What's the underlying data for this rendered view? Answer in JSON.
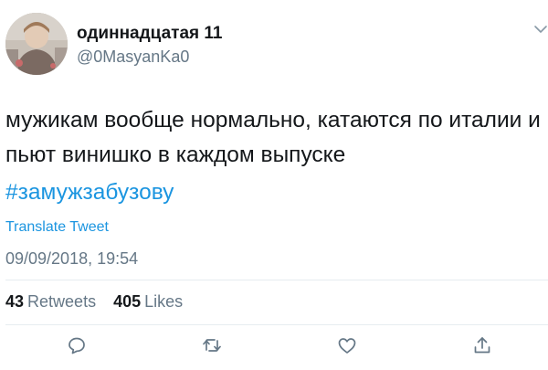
{
  "tweet": {
    "display_name": "одиннадцатая 11",
    "handle": "@0MasyanKa0",
    "text": "мужикам вообще нормально, катаются по италии и пьют винишко в каждом выпуске",
    "hashtag": "#замужзабузову",
    "translate_label": "Translate Tweet",
    "timestamp": "09/09/2018, 19:54"
  },
  "stats": {
    "retweets_count": "43",
    "retweets_label": "Retweets",
    "likes_count": "405",
    "likes_label": "Likes"
  },
  "icons": {
    "reply": "reply-icon",
    "retweet": "retweet-icon",
    "like": "like-icon",
    "share": "share-icon",
    "menu": "chevron-down-icon"
  },
  "colors": {
    "link": "#1b95e0",
    "secondary_text": "#657786",
    "primary_text": "#14171a",
    "divider": "#e6ecf0"
  }
}
